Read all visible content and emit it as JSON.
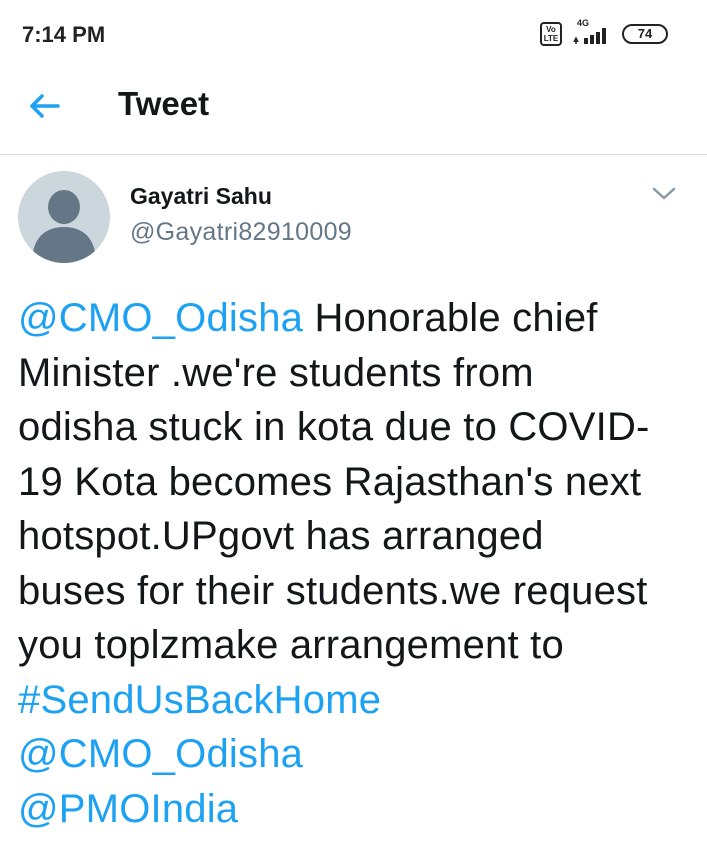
{
  "status_bar": {
    "time": "7:14 PM",
    "volte_label": "Vo LTE",
    "network_type": "4G",
    "battery_level": "74"
  },
  "header": {
    "title": "Tweet",
    "back_icon": "back-arrow-icon"
  },
  "tweet": {
    "author_name": "Gayatri Sahu",
    "author_handle": "@Gayatri82910009",
    "caret_icon": "chevron-down-icon",
    "lines": {
      "l1_mention": "@CMO_Odisha",
      "l1_text": " Honorable chief",
      "l2_text": "Minister .we're students from",
      "l3_text": "odisha stuck in kota due to COVID-",
      "l4_text": "19 Kota becomes Rajasthan's next",
      "l5_text": "hotspot.UPgovt has arranged",
      "l6_text": "buses for their students.we request",
      "l7_text": "you toplzmake arrangement to",
      "l8_hashtag": "#SendUsBackHome",
      "l9_mention": "@CMO_Odisha",
      "l10_mention": "@PMOIndia"
    }
  },
  "colors": {
    "link": "#1da1f2",
    "text": "#14171a",
    "secondary": "#657786",
    "avatar_bg": "#ccd6dd",
    "avatar_fg": "#657786"
  }
}
